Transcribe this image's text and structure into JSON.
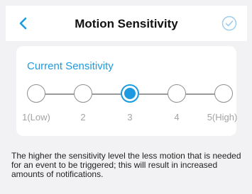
{
  "header": {
    "title": "Motion Sensitivity",
    "back_icon": "chevron-left-icon",
    "confirm_icon": "check-circle-icon",
    "accent_color": "#1e9be0"
  },
  "sensitivity": {
    "heading": "Current Sensitivity",
    "selected_index": 2,
    "levels": [
      {
        "label": "1(Low)"
      },
      {
        "label": "2"
      },
      {
        "label": "3"
      },
      {
        "label": "4"
      },
      {
        "label": "5(High)"
      }
    ]
  },
  "description": "The higher the sensitivity level the less motion that is needed for an event to be triggered; this will result in increased amounts of notifications."
}
